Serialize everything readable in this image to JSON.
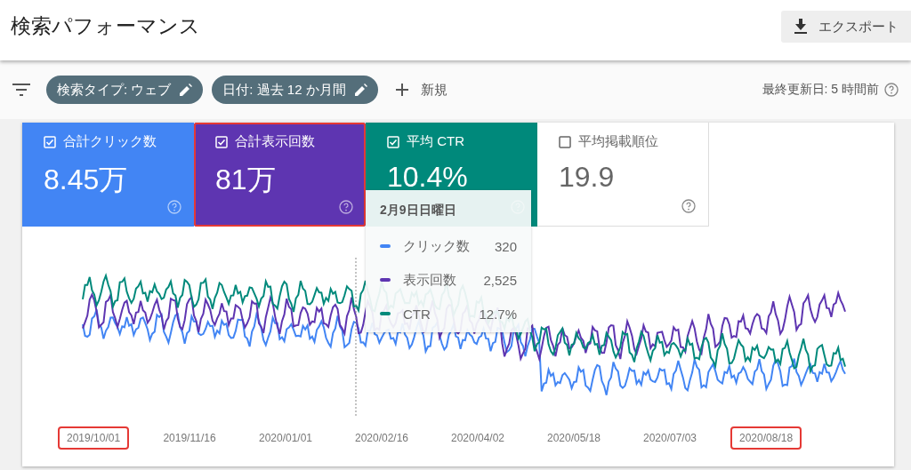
{
  "header": {
    "title": "検索パフォーマンス",
    "export_button": "エクスポート"
  },
  "filter_bar": {
    "chips": [
      "検索タイプ: ウェブ",
      "日付: 過去 12 か月間"
    ],
    "new_button": "新規",
    "last_updated": "最終更新日: 5 時間前"
  },
  "metric_cards": [
    {
      "label": "合計クリック数",
      "value": "8.45万",
      "checked": true,
      "color": "#4285f4",
      "highlighted": false
    },
    {
      "label": "合計表示回数",
      "value": "81万",
      "checked": true,
      "color": "#5e35b1",
      "highlighted": true
    },
    {
      "label": "平均 CTR",
      "value": "10.4%",
      "checked": true,
      "color": "#00897b",
      "highlighted": false
    },
    {
      "label": "平均掲載順位",
      "value": "19.9",
      "checked": false,
      "highlighted": false
    }
  ],
  "tooltip": {
    "date": "2月9日日曜日",
    "rows": [
      {
        "label": "クリック数",
        "value": "320",
        "color": "#4285f4"
      },
      {
        "label": "表示回数",
        "value": "2,525",
        "color": "#5e35b1"
      },
      {
        "label": "CTR",
        "value": "12.7%",
        "color": "#00897b"
      }
    ]
  },
  "x_labels": [
    {
      "text": "2019/10/01",
      "highlighted": true
    },
    {
      "text": "2019/11/16",
      "highlighted": false
    },
    {
      "text": "2020/01/01",
      "highlighted": false
    },
    {
      "text": "2020/02/16",
      "highlighted": false
    },
    {
      "text": "2020/04/02",
      "highlighted": false
    },
    {
      "text": "2020/05/18",
      "highlighted": false
    },
    {
      "text": "2020/07/03",
      "highlighted": false
    },
    {
      "text": "2020/08/18",
      "highlighted": true
    }
  ]
}
